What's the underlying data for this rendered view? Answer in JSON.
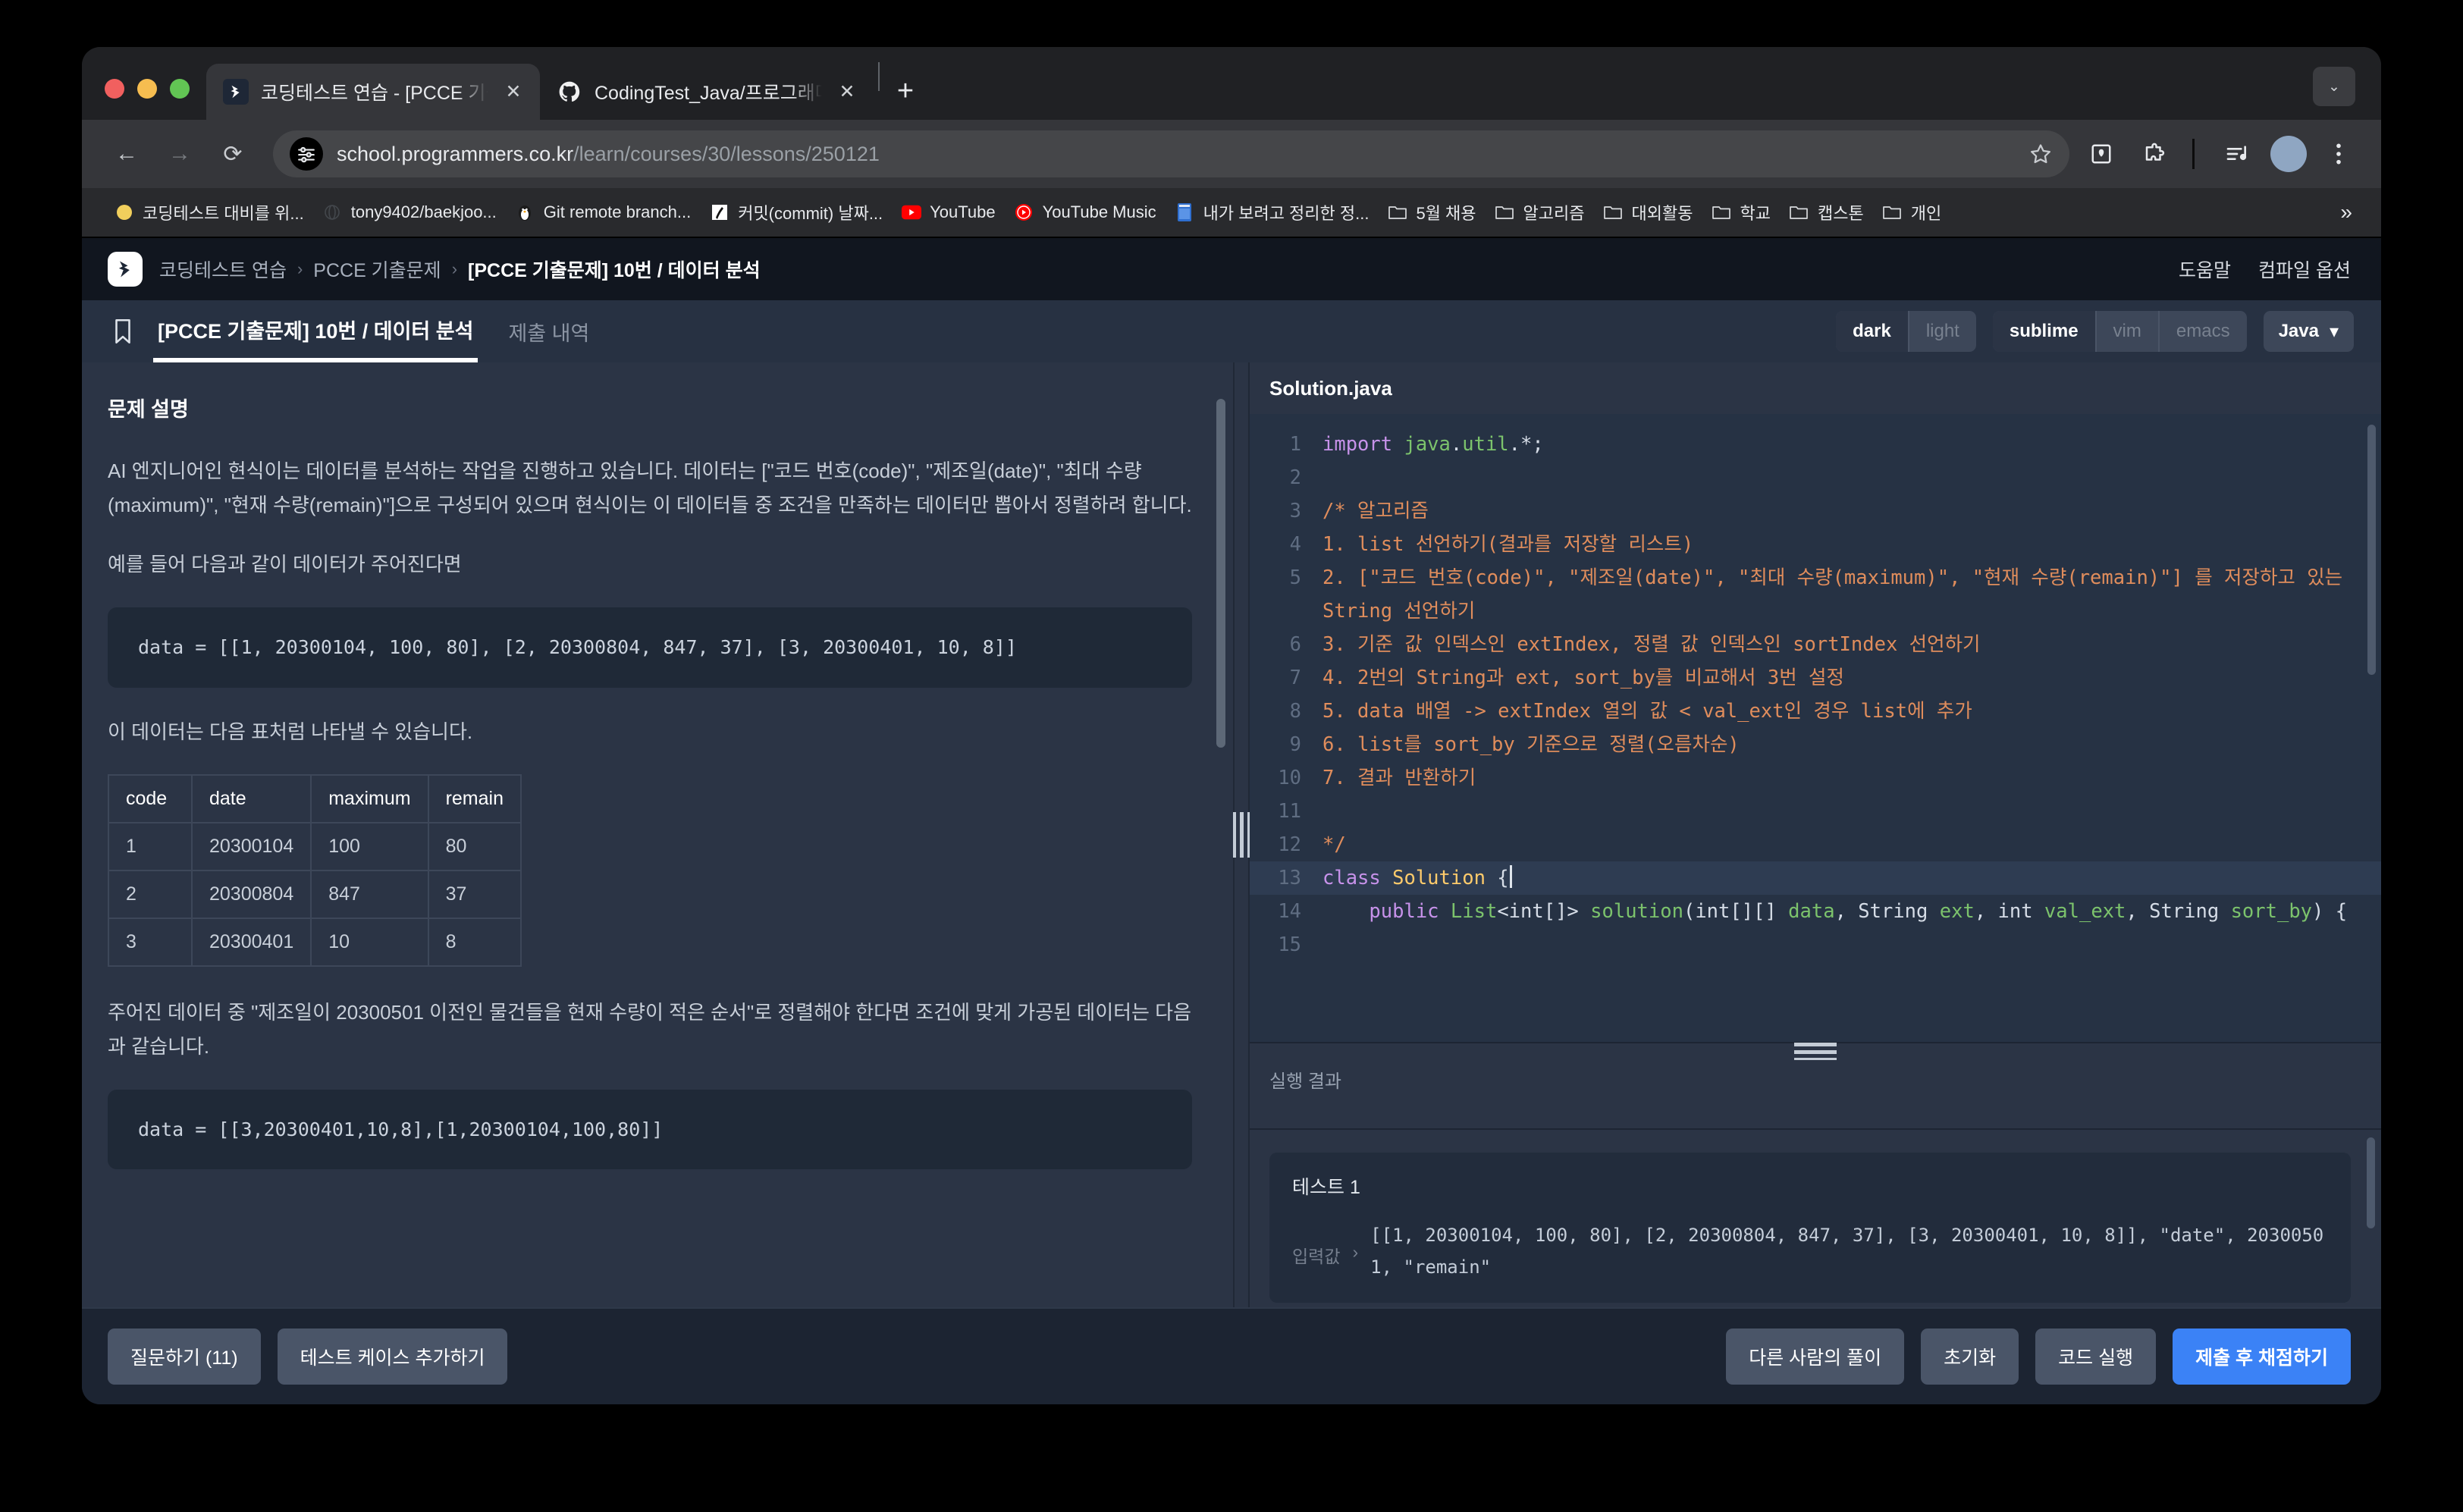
{
  "browser": {
    "tabs": [
      {
        "title": "코딩테스트 연습 - [PCCE 기출문제",
        "favicon": "programmers-icon",
        "active": true
      },
      {
        "title": "CodingTest_Java/프로그래머스/",
        "favicon": "github-icon",
        "active": false
      }
    ],
    "new_tab_label": "+",
    "tab_list_label": "⌄",
    "nav": {
      "back": "←",
      "forward": "→",
      "reload": "⟳"
    },
    "url_host": "school.programmers.co.kr",
    "url_path": "/learn/courses/30/lessons/250121",
    "toolbar_icons": [
      "bookmark-star-icon",
      "reading-mode-icon",
      "extensions-icon",
      "media-controls-icon",
      "profile-avatar",
      "chrome-menu-icon"
    ],
    "bookmarks": [
      {
        "label": "코딩테스트 대비를 위...",
        "icon": "yellow-circle-icon"
      },
      {
        "label": "tony9402/baekjoo...",
        "icon": "globe-icon"
      },
      {
        "label": "Git remote branch...",
        "icon": "penguin-icon"
      },
      {
        "label": "커밋(commit) 날짜...",
        "icon": "note-icon"
      },
      {
        "label": "YouTube",
        "icon": "youtube-icon"
      },
      {
        "label": "YouTube Music",
        "icon": "youtube-music-icon"
      },
      {
        "label": "내가 보려고 정리한 정...",
        "icon": "book-icon"
      },
      {
        "label": "5월 채용",
        "icon": "folder-icon"
      },
      {
        "label": "알고리즘",
        "icon": "folder-icon"
      },
      {
        "label": "대외활동",
        "icon": "folder-icon"
      },
      {
        "label": "학교",
        "icon": "folder-icon"
      },
      {
        "label": "캡스톤",
        "icon": "folder-icon"
      },
      {
        "label": "개인",
        "icon": "folder-icon"
      }
    ],
    "bookmarks_overflow": "»"
  },
  "site": {
    "breadcrumb": [
      "코딩테스트 연습",
      "PCCE 기출문제",
      "[PCCE 기출문제] 10번 / 데이터 분석"
    ],
    "breadcrumb_sep": "›",
    "header_links": [
      "도움말",
      "컴파일 옵션"
    ]
  },
  "subbar": {
    "bookmark_icon": "bookmark-outline-icon",
    "tab_active": "[PCCE 기출문제] 10번 / 데이터 분석",
    "tab_inactive": "제출 내역",
    "theme_options": [
      "dark",
      "light"
    ],
    "theme_selected": "dark",
    "keymap_options": [
      "sublime",
      "vim",
      "emacs"
    ],
    "keymap_selected": "sublime",
    "language": "Java",
    "language_caret": "▾"
  },
  "problem": {
    "section_title": "문제 설명",
    "paragraph1": "AI 엔지니어인 현식이는 데이터를 분석하는 작업을 진행하고 있습니다. 데이터는 [\"코드 번호(code)\", \"제조일(date)\", \"최대 수량(maximum)\", \"현재 수량(remain)\"]으로 구성되어 있으며 현식이는 이 데이터들 중 조건을 만족하는 데이터만 뽑아서 정렬하려 합니다.",
    "paragraph2": "예를 들어 다음과 같이 데이터가 주어진다면",
    "code1": "data = [[1, 20300104, 100, 80], [2, 20300804, 847, 37], [3, 20300401, 10, 8]]",
    "paragraph3": "이 데이터는 다음 표처럼 나타낼 수 있습니다.",
    "table": {
      "headers": [
        "code",
        "date",
        "maximum",
        "remain"
      ],
      "rows": [
        [
          "1",
          "20300104",
          "100",
          "80"
        ],
        [
          "2",
          "20300804",
          "847",
          "37"
        ],
        [
          "3",
          "20300401",
          "10",
          "8"
        ]
      ]
    },
    "paragraph4": "주어진 데이터 중 \"제조일이 20300501 이전인 물건들을 현재 수량이 적은 순서\"로 정렬해야 한다면 조건에 맞게 가공된 데이터는 다음과 같습니다.",
    "code2": "data = [[3,20300401,10,8],[1,20300104,100,80]]"
  },
  "editor": {
    "filename": "Solution.java",
    "lines": [
      {
        "n": "1",
        "segments": [
          {
            "t": "import ",
            "c": "k-kw"
          },
          {
            "t": "java",
            "c": "k-grn"
          },
          {
            "t": ".",
            "c": "k-pun"
          },
          {
            "t": "util",
            "c": "k-grn"
          },
          {
            "t": ".*;",
            "c": "k-pun"
          }
        ]
      },
      {
        "n": "2",
        "segments": []
      },
      {
        "n": "3",
        "segments": [
          {
            "t": "/* 알고리즘",
            "c": "k-cmt"
          }
        ]
      },
      {
        "n": "4",
        "segments": [
          {
            "t": "1. list 선언하기(결과를 저장할 리스트)",
            "c": "k-cmt"
          }
        ]
      },
      {
        "n": "5",
        "segments": [
          {
            "t": "2. [\"코드 번호(code)\", \"제조일(date)\", \"최대 수량(maximum)\", \"현재 수량(remain)\"] 를 저장하고 있는 String 선언하기",
            "c": "k-cmt"
          }
        ]
      },
      {
        "n": "6",
        "segments": [
          {
            "t": "3. 기준 값 인덱스인 extIndex, 정렬 값 인덱스인 sortIndex 선언하기",
            "c": "k-cmt"
          }
        ]
      },
      {
        "n": "7",
        "segments": [
          {
            "t": "4. 2번의 String과 ext, sort_by를 비교해서 3번 설정",
            "c": "k-cmt"
          }
        ]
      },
      {
        "n": "8",
        "segments": [
          {
            "t": "5. data 배열 -> extIndex 열의 값 < val_ext인 경우 list에 추가",
            "c": "k-cmt"
          }
        ]
      },
      {
        "n": "9",
        "segments": [
          {
            "t": "6. list를 sort_by 기준으로 정렬(오름차순)",
            "c": "k-cmt"
          }
        ]
      },
      {
        "n": "10",
        "segments": [
          {
            "t": "7. 결과 반환하기",
            "c": "k-cmt"
          }
        ]
      },
      {
        "n": "11",
        "segments": []
      },
      {
        "n": "12",
        "segments": [
          {
            "t": "*/",
            "c": "k-cmt"
          }
        ]
      },
      {
        "n": "13",
        "current": true,
        "segments": [
          {
            "t": "class ",
            "c": "k-kw"
          },
          {
            "t": "Solution",
            "c": "k-cls"
          },
          {
            "t": " {",
            "c": "k-pun"
          }
        ],
        "caret": true
      },
      {
        "n": "14",
        "segments": [
          {
            "t": "    public ",
            "c": "k-kw"
          },
          {
            "t": "List",
            "c": "k-grn"
          },
          {
            "t": "<int[]> ",
            "c": "k-pun"
          },
          {
            "t": "solution",
            "c": "k-grn"
          },
          {
            "t": "(int[][] ",
            "c": "k-pun"
          },
          {
            "t": "data",
            "c": "k-grn"
          },
          {
            "t": ", String ",
            "c": "k-pun"
          },
          {
            "t": "ext",
            "c": "k-grn"
          },
          {
            "t": ", int ",
            "c": "k-pun"
          },
          {
            "t": "val_ext",
            "c": "k-grn"
          },
          {
            "t": ", String ",
            "c": "k-pun"
          },
          {
            "t": "sort_by",
            "c": "k-grn"
          },
          {
            "t": ") {",
            "c": "k-pun"
          }
        ]
      },
      {
        "n": "15",
        "segments": []
      }
    ]
  },
  "result": {
    "title": "실행 결과",
    "test_name": "테스트 1",
    "input_label": "입력값",
    "input_chevron": "›",
    "input_value": "[[1, 20300104, 100, 80], [2, 20300804, 847, 37], [3, 20300401, 10, 8]], \"date\", 20300501, \"remain\""
  },
  "footer": {
    "left_buttons": [
      "질문하기 (11)",
      "테스트 케이스 추가하기"
    ],
    "right_buttons": [
      "다른 사람의 풀이",
      "초기화",
      "코드 실행"
    ],
    "primary_button": "제출 후 채점하기",
    "primary_color": "#3b82f6"
  }
}
